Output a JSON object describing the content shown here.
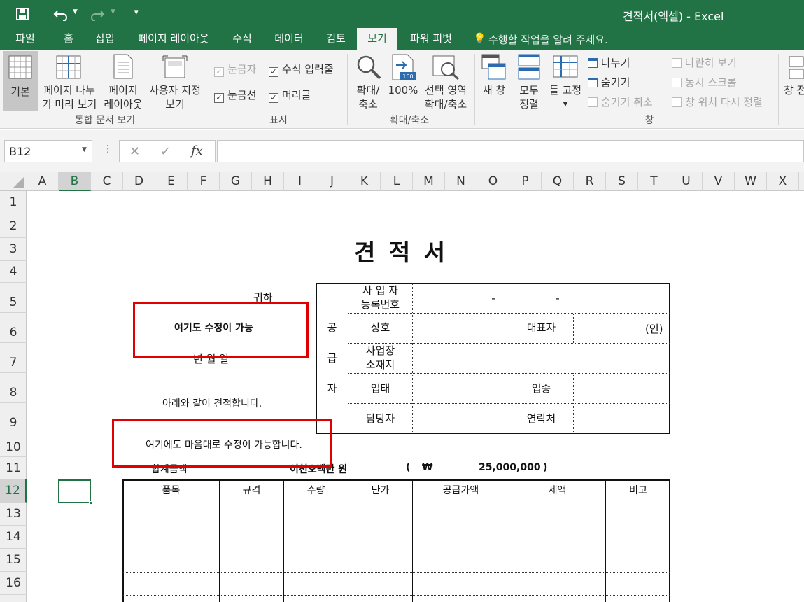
{
  "window": {
    "title": "견적서(엑셀) - Excel"
  },
  "tabs": [
    {
      "label": "파일"
    },
    {
      "label": "홈"
    },
    {
      "label": "삽입"
    },
    {
      "label": "페이지 레이아웃"
    },
    {
      "label": "수식"
    },
    {
      "label": "데이터"
    },
    {
      "label": "검토"
    },
    {
      "label": "보기"
    },
    {
      "label": "파워 피벗"
    }
  ],
  "tell_me": "수행할 작업을 알려 주세요.",
  "ribbon": {
    "views": {
      "normal": "기본",
      "pagebreak_1": "페이지 나누",
      "pagebreak_2": "기 미리 보기",
      "layout_1": "페이지",
      "layout_2": "레이아웃",
      "custom_1": "사용자 지정",
      "custom_2": "보기",
      "group": "통합 문서 보기"
    },
    "show": {
      "ruler": "눈금자",
      "formula_bar": "수식 입력줄",
      "gridlines": "눈금선",
      "headings": "머리글",
      "group": "표시"
    },
    "zoom": {
      "zoom_1": "확대/",
      "zoom_2": "축소",
      "z100": "100%",
      "sel_1": "선택 영역",
      "sel_2": "확대/축소",
      "group": "확대/축소",
      "icon_text": "100"
    },
    "window": {
      "new": "새 창",
      "arrange_1": "모두",
      "arrange_2": "정렬",
      "freeze": "틀 고정",
      "split": "나누기",
      "hide": "숨기기",
      "unhide": "숨기기 취소",
      "side": "나란히 보기",
      "sync": "동시 스크롤",
      "reset": "창 위치 다시 정렬",
      "switch": "창 전",
      "group": "창"
    }
  },
  "formula_bar": {
    "name_box": "B12",
    "fx": "fx",
    "value": ""
  },
  "columns": [
    "A",
    "B",
    "C",
    "D",
    "E",
    "F",
    "G",
    "H",
    "I",
    "J",
    "K",
    "L",
    "M",
    "N",
    "O",
    "P",
    "Q",
    "R",
    "S",
    "T",
    "U",
    "V",
    "W",
    "X"
  ],
  "rows": [
    "1",
    "2",
    "3",
    "4",
    "5",
    "6",
    "7",
    "8",
    "9",
    "10",
    "11",
    "12",
    "13",
    "14",
    "15",
    "16"
  ],
  "sheet": {
    "title": "견 적 서",
    "recipient": "귀하",
    "editable_note_1": "여기도 수정이 가능",
    "date": "년  월  일",
    "greeting": "아래와 같이 견적합니다.",
    "editable_note_2": "여기에도 마음대로 수정이 가능합니다.",
    "total_label": "합계금액",
    "total_korean": "이천오백만  원",
    "total_open": "(",
    "won": "₩",
    "total_value": "25,000,000",
    "total_close": ")",
    "supplier": {
      "side_1": "공",
      "side_2": "급",
      "side_3": "자",
      "biz_no_1": "사 업 자",
      "biz_no_2": "등록번호",
      "biz_dash_1": "-",
      "biz_dash_2": "-",
      "name": "상호",
      "ceo": "대표자",
      "seal": "(인)",
      "addr_1": "사업장",
      "addr_2": "소재지",
      "type": "업태",
      "item": "업종",
      "manager": "담당자",
      "contact": "연락처"
    },
    "table_headers": [
      "품목",
      "규격",
      "수량",
      "단가",
      "공급가액",
      "세액",
      "비고"
    ]
  },
  "colors": {
    "excel_green": "#217346",
    "annotation_red": "#e00000"
  }
}
